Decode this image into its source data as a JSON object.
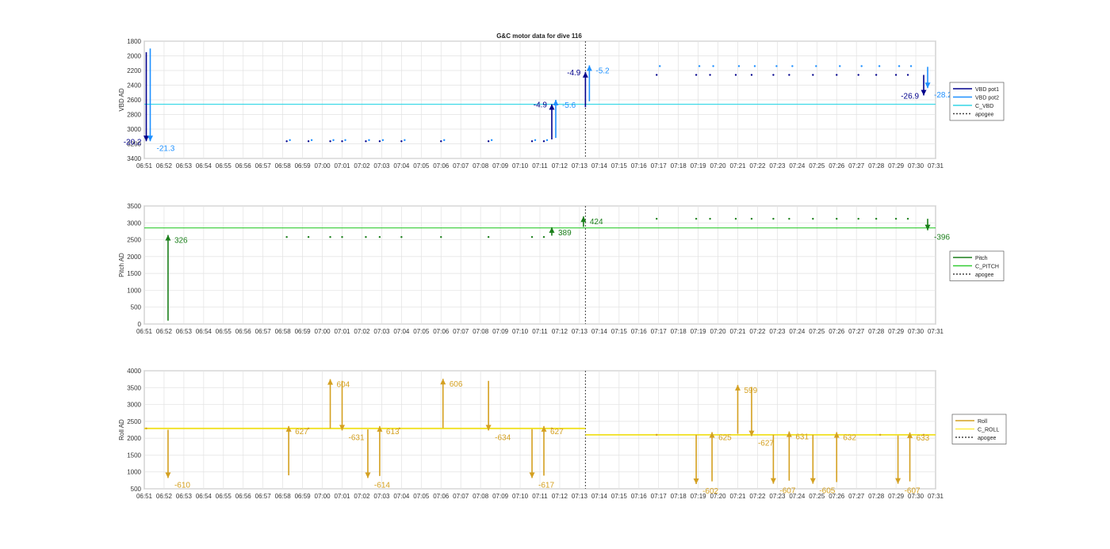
{
  "figure": {
    "title": "G&C motor data for dive 116",
    "time_ticks": [
      "06:51",
      "06:52",
      "06:53",
      "06:54",
      "06:55",
      "06:56",
      "06:57",
      "06:58",
      "06:59",
      "07:00",
      "07:01",
      "07:02",
      "07:03",
      "07:04",
      "07:05",
      "07:06",
      "07:07",
      "07:08",
      "07:09",
      "07:10",
      "07:11",
      "07:12",
      "07:13",
      "07:14",
      "07:15",
      "07:16",
      "07:17",
      "07:18",
      "07:19",
      "07:20",
      "07:21",
      "07:22",
      "07:23",
      "07:24",
      "07:25",
      "07:26",
      "07:27",
      "07:28",
      "07:29",
      "07:30",
      "07:31"
    ]
  },
  "chart_data": [
    {
      "type": "line",
      "ylabel": "VBD AD",
      "ylim": [
        1800,
        3400
      ],
      "y_reversed": true,
      "yticks": [
        1800,
        2000,
        2200,
        2400,
        2600,
        2800,
        3000,
        3200,
        3400
      ],
      "xlim_minutes": [
        0,
        40
      ],
      "grid": true,
      "legend_position": "right",
      "legend": [
        "VBD pot1",
        "VBD pot2",
        "C_VBD",
        "apogee"
      ],
      "colors": {
        "pot1": "#00008b",
        "pot2": "#1e90ff",
        "cmd": "#33d6e6",
        "apogee": "#444444"
      },
      "reference_line": {
        "name": "C_VBD",
        "value": 2660
      },
      "apogee_minute": 22.3,
      "series": [
        {
          "name": "VBD pot1",
          "x": [
            10.8,
            12.8,
            15.8,
            17.8,
            19.0,
            21.0,
            22.8,
            24.8,
            27.0,
            29.0,
            31.0,
            32.8,
            33.6,
            34.8,
            35.6,
            36.8,
            38.0,
            39.0,
            40.2,
            41.2,
            41.8,
            43.0,
            44.0,
            45.6,
            46.8
          ],
          "y": [
            3160,
            3160,
            3160,
            3160,
            3160,
            3160,
            3160,
            3160,
            3160,
            3160,
            3160,
            3160,
            3160,
            3160,
            3160,
            3160,
            3160,
            3160,
            3160,
            3160,
            3160,
            3160,
            3160,
            3160,
            3160
          ]
        }
      ],
      "annotations": [
        {
          "label": "-20.2",
          "x": 0.1,
          "y_from": 1950,
          "y_to": 3165,
          "color": "pot1"
        },
        {
          "label": "-21.3",
          "x": 0.3,
          "y_from": 1900,
          "y_to": 3165,
          "color": "pot2"
        },
        {
          "label": "-4.9",
          "x": 20.6,
          "y_from": 3140,
          "y_to": 2660,
          "color": "pot1"
        },
        {
          "label": "-5.6",
          "x": 20.8,
          "y_from": 3120,
          "y_to": 2600,
          "color": "pot2"
        },
        {
          "label": "-4.9",
          "x": 22.3,
          "y_from": 2700,
          "y_to": 2220,
          "color": "pot1"
        },
        {
          "label": "-5.2",
          "x": 22.5,
          "y_from": 2620,
          "y_to": 2130,
          "color": "pot2"
        },
        {
          "label": "-26.9",
          "x": 39.4,
          "y_from": 2260,
          "y_to": 2540,
          "color": "pot1"
        },
        {
          "label": "-28.2",
          "x": 39.6,
          "y_from": 2150,
          "y_to": 2440,
          "color": "pot2"
        }
      ]
    },
    {
      "type": "line",
      "ylabel": "Pitch AD",
      "ylim": [
        0,
        3500
      ],
      "yticks": [
        0,
        500,
        1000,
        1500,
        2000,
        2500,
        3000,
        3500
      ],
      "grid": true,
      "legend_position": "right",
      "legend": [
        "Pitch",
        "C_PITCH",
        "apogee"
      ],
      "colors": {
        "pitch": "#1a7f1a",
        "cmd": "#33cc33"
      },
      "reference_line": {
        "name": "C_PITCH",
        "value": 2850
      },
      "annotations": [
        {
          "label": "326",
          "x": 1.2,
          "y_from": 100,
          "y_to": 2640
        },
        {
          "label": "389",
          "x": 20.6,
          "y_from": 2620,
          "y_to": 2870
        },
        {
          "label": "424",
          "x": 22.2,
          "y_from": 2880,
          "y_to": 3190
        },
        {
          "label": "-396",
          "x": 39.6,
          "y_from": 3120,
          "y_to": 2780
        }
      ]
    },
    {
      "type": "line",
      "ylabel": "Roll AD",
      "ylim": [
        500,
        4000
      ],
      "yticks": [
        500,
        1000,
        1500,
        2000,
        2500,
        3000,
        3500,
        4000
      ],
      "grid": true,
      "legend_position": "right",
      "legend": [
        "Roll",
        "C_ROLL",
        "apogee"
      ],
      "colors": {
        "roll": "#d4a020",
        "cmd": "#ffee44"
      },
      "reference_lines": [
        {
          "name": "C_ROLL",
          "value": 2290,
          "x_from": 0,
          "x_to": 22.3
        },
        {
          "name": "C_ROLL",
          "value": 2100,
          "x_from": 22.3,
          "x_to": 40
        }
      ],
      "annotations": [
        {
          "label": "-610",
          "x": 1.2,
          "y_from": 2250,
          "y_to": 820
        },
        {
          "label": "627",
          "x": 7.3,
          "y_from": 900,
          "y_to": 2360
        },
        {
          "label": "604",
          "x": 9.4,
          "y_from": 2290,
          "y_to": 3750
        },
        {
          "label": "-631",
          "x": 10.0,
          "y_from": 3700,
          "y_to": 2230
        },
        {
          "label": "-614",
          "x": 11.3,
          "y_from": 2260,
          "y_to": 820
        },
        {
          "label": "613",
          "x": 11.9,
          "y_from": 880,
          "y_to": 2360
        },
        {
          "label": "606",
          "x": 15.1,
          "y_from": 2300,
          "y_to": 3760
        },
        {
          "label": "-634",
          "x": 17.4,
          "y_from": 3700,
          "y_to": 2230
        },
        {
          "label": "-617",
          "x": 19.6,
          "y_from": 2270,
          "y_to": 820
        },
        {
          "label": "627",
          "x": 20.2,
          "y_from": 890,
          "y_to": 2360
        },
        {
          "label": "-602",
          "x": 27.9,
          "y_from": 2100,
          "y_to": 640
        },
        {
          "label": "625",
          "x": 28.7,
          "y_from": 720,
          "y_to": 2180
        },
        {
          "label": "599",
          "x": 30.0,
          "y_from": 2130,
          "y_to": 3580
        },
        {
          "label": "-627",
          "x": 30.7,
          "y_from": 3520,
          "y_to": 2060
        },
        {
          "label": "-607",
          "x": 31.8,
          "y_from": 2100,
          "y_to": 650
        },
        {
          "label": "631",
          "x": 32.6,
          "y_from": 740,
          "y_to": 2200
        },
        {
          "label": "-605",
          "x": 33.8,
          "y_from": 2100,
          "y_to": 650
        },
        {
          "label": "632",
          "x": 35.0,
          "y_from": 700,
          "y_to": 2180
        },
        {
          "label": "-607",
          "x": 38.1,
          "y_from": 2080,
          "y_to": 650
        },
        {
          "label": "633",
          "x": 38.7,
          "y_from": 720,
          "y_to": 2170
        }
      ]
    }
  ],
  "legends": {
    "vbd": [
      "VBD pot1",
      "VBD pot2",
      "C_VBD",
      "apogee"
    ],
    "pitch": [
      "Pitch",
      "C_PITCH",
      "apogee"
    ],
    "roll": [
      "Roll",
      "C_ROLL",
      "apogee"
    ]
  }
}
